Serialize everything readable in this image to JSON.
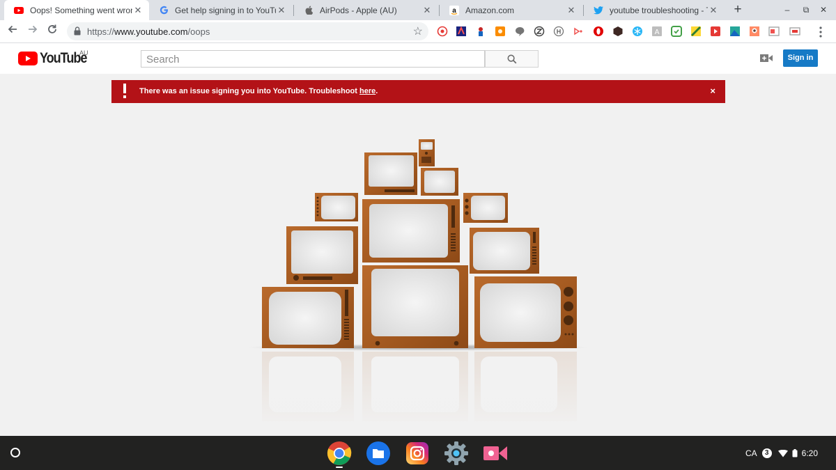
{
  "browser": {
    "tabs": [
      {
        "title": "Oops! Something went wrong.",
        "favicon": "youtube-favicon",
        "active": true
      },
      {
        "title": "Get help signing in to YouTube",
        "favicon": "google-favicon",
        "active": false
      },
      {
        "title": "AirPods - Apple (AU)",
        "favicon": "apple-favicon",
        "active": false
      },
      {
        "title": "Amazon.com",
        "favicon": "amazon-favicon",
        "active": false
      },
      {
        "title": "youtube troubleshooting - Twitter",
        "favicon": "twitter-favicon",
        "active": false
      }
    ],
    "tab_close_glyph": "✕",
    "new_tab_glyph": "+",
    "url_prefix": "https://",
    "url_host": "www.youtube.com",
    "url_path": "/oops",
    "window_controls": {
      "minimize": "–",
      "restore": "⧉",
      "close": "✕"
    }
  },
  "youtube": {
    "logo_text": "YouTube",
    "country_code": "AU",
    "search_placeholder": "Search",
    "sign_in_label": "Sign in",
    "brand_red": "#ff0000",
    "sign_in_color": "#167ac6"
  },
  "alert": {
    "message": "There was an issue signing you into YouTube. Troubleshoot ",
    "link_text": "here",
    "suffix": ".",
    "close_glyph": "×",
    "color": "#b31217"
  },
  "shelf": {
    "apps": [
      "chrome-icon",
      "files-icon",
      "instagram-icon",
      "settings-icon",
      "screencast-icon"
    ],
    "ime": "CA",
    "notification_count": "3",
    "time": "6:20"
  }
}
